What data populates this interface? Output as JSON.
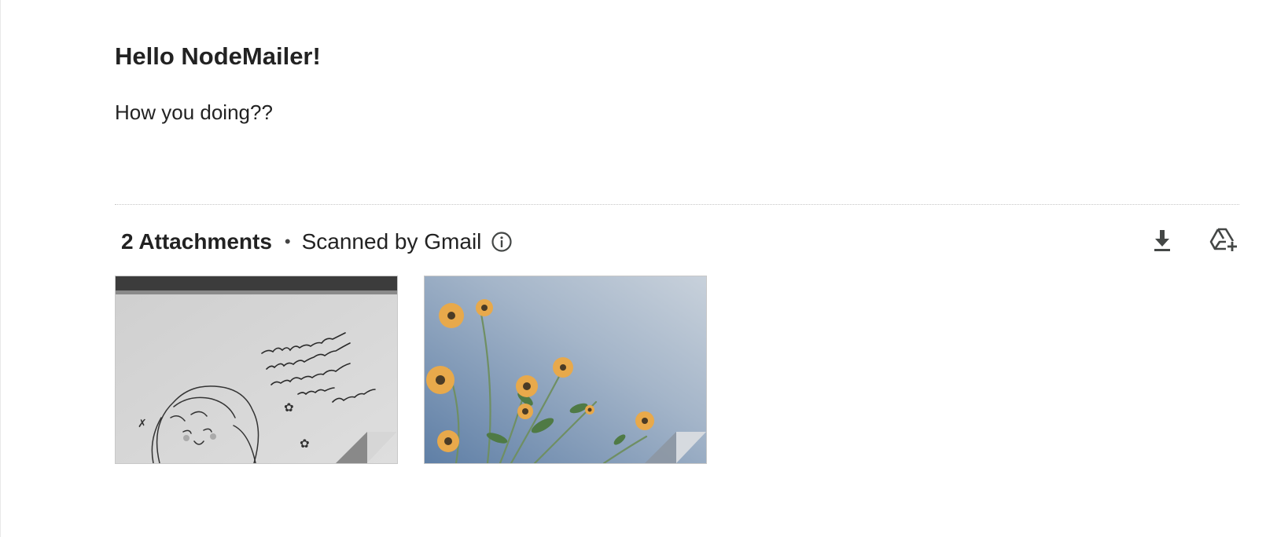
{
  "email": {
    "heading": "Hello NodeMailer!",
    "body_text": "How you doing??"
  },
  "attachments": {
    "count_label": "2 Attachments",
    "separator": "•",
    "scanned_label": "Scanned by Gmail",
    "icons": {
      "info": "info-icon",
      "download_all": "download-icon",
      "save_to_drive": "add-to-drive-icon"
    },
    "items": [
      {
        "kind": "image",
        "description_icon": "sketch-image-thumbnail"
      },
      {
        "kind": "image",
        "description_icon": "flowers-image-thumbnail"
      }
    ]
  },
  "colors": {
    "text": "#222222",
    "icon": "#444746",
    "divider": "#c6c6c6",
    "sky": "#7d98b8",
    "flower": "#e8a94b"
  }
}
